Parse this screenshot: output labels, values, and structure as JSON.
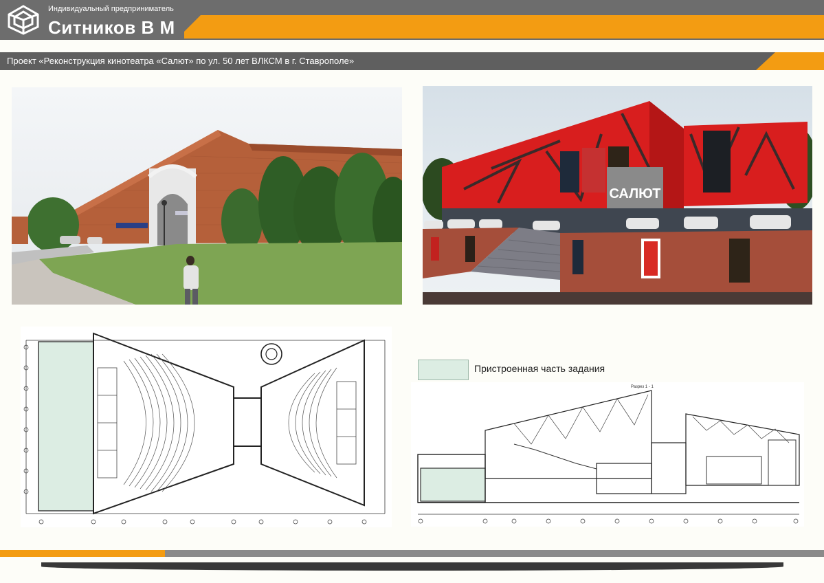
{
  "header": {
    "subtitle": "Индивидуальный предприниматель",
    "name": "Ситников В М",
    "project_title": "Проект «Реконструкция кинотеатра «Салют» по ул. 50 лет ВЛКСМ в г. Ставрополе»"
  },
  "render": {
    "sign_text": "САЛЮТ"
  },
  "legend": {
    "label": "Пристроенная часть задания",
    "color": "#dcede3"
  },
  "section": {
    "title": "Разрез 1 - 1"
  },
  "colors": {
    "header_grey": "#6d6d6d",
    "accent_orange": "#f39c12",
    "facade_red": "#d81e1e",
    "brick": "#b5603a"
  }
}
